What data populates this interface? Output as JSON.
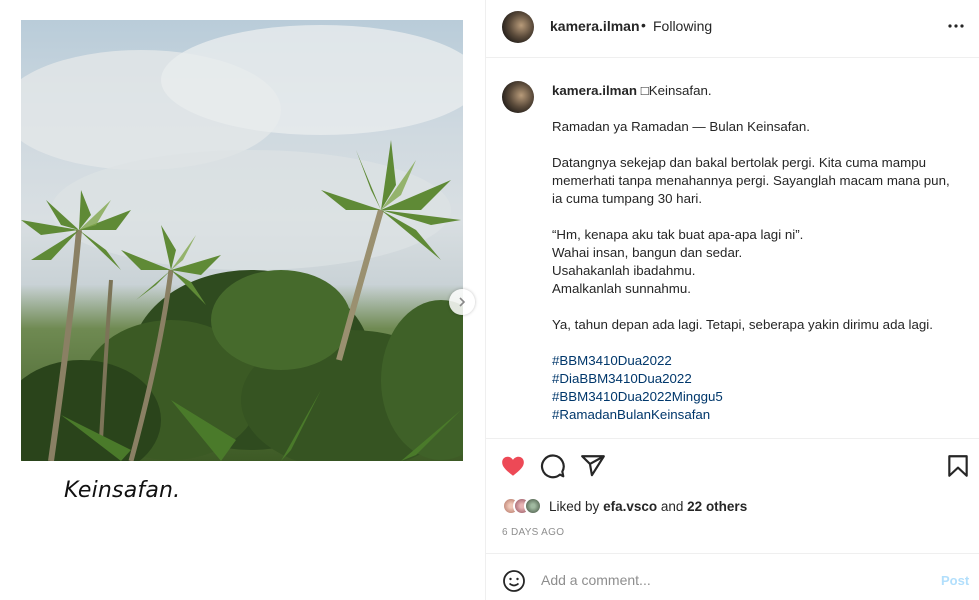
{
  "post": {
    "username": "kamera.ilman",
    "follow_label": "Following",
    "separator": "•",
    "image_caption": "Keinsafan.",
    "text": {
      "first_line": "□Keinsafan.",
      "line_ramadan": "Ramadan ya Ramadan — Bulan Keinsafan.",
      "para2": [
        "Datangnya sekejap dan bakal bertolak pergi. Kita cuma mampu",
        "memerhati tanpa menahannya pergi. Sayanglah macam mana pun,",
        "ia cuma tumpang 30 hari."
      ],
      "para3": [
        "“Hm, kenapa aku tak buat apa-apa lagi ni”.",
        "Wahai insan, bangun dan sedar.",
        "Usahakanlah ibadahmu.",
        "Amalkanlah sunnahmu."
      ],
      "para4": "Ya, tahun depan ada lagi. Tetapi, seberapa yakin dirimu ada lagi.",
      "hashtags": [
        "#BBM3410Dua2022",
        "#DiaBBM3410Dua2022",
        "#BBM3410Dua2022Minggu5",
        "#RamadanBulanKeinsafan"
      ]
    }
  },
  "actions": {
    "liked": true,
    "icons": [
      "heart-icon",
      "comment-icon",
      "share-icon",
      "bookmark-icon"
    ],
    "likes_prefix": "Liked by",
    "likes_user": "efa.vsco",
    "likes_and": "and",
    "likes_others": "22 others",
    "timestamp": "6 DAYS AGO"
  },
  "comment_box": {
    "placeholder": "Add a comment...",
    "post_label": "Post"
  },
  "colors": {
    "heart": "#ed4956",
    "hashtag": "#00376b",
    "post_button_disabled": "#b2dffc",
    "muted": "#8e8e8e"
  }
}
